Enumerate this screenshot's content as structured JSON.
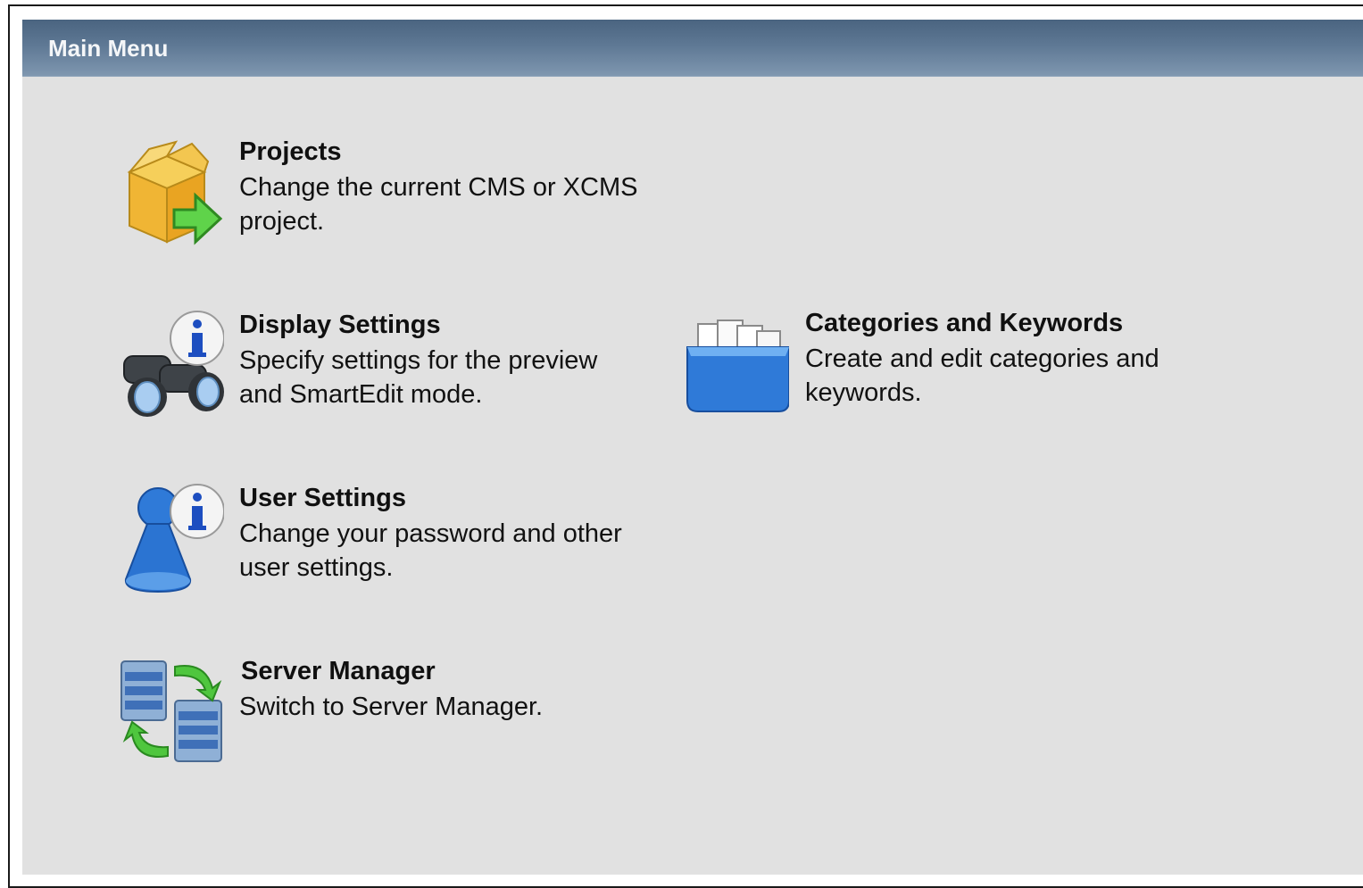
{
  "panel": {
    "title": "Main Menu"
  },
  "items": [
    {
      "id": "projects",
      "title": "Projects",
      "desc_line1": "Change the current CMS or XCMS",
      "desc_line2": "project.",
      "icon": "box-arrow-icon"
    },
    {
      "id": "display-settings",
      "title": "Display Settings",
      "desc_line1": "Specify settings for the preview",
      "desc_line2": "and SmartEdit mode.",
      "icon": "binoculars-info-icon"
    },
    {
      "id": "categories-keywords",
      "title": "Categories and Keywords",
      "desc_line1": "Create and edit categories and",
      "desc_line2": "keywords.",
      "icon": "folder-tray-icon"
    },
    {
      "id": "user-settings",
      "title": "User Settings",
      "desc_line1": "Change your password and other",
      "desc_line2": "user settings.",
      "icon": "user-info-icon"
    },
    {
      "id": "server-manager",
      "title": "Server Manager",
      "desc_line1": "Switch to Server Manager.",
      "desc_line2": "",
      "icon": "servers-sync-icon"
    }
  ],
  "colors": {
    "header": "#5e7894",
    "panel": "#e1e1e1",
    "text": "#111111"
  }
}
